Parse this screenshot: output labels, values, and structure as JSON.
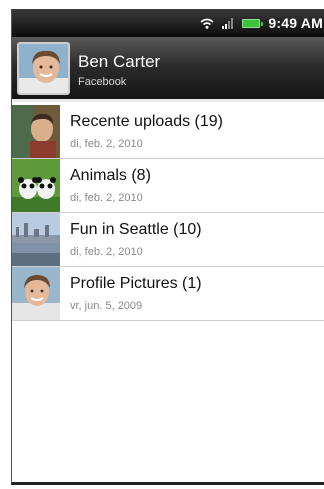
{
  "status_bar": {
    "time": "9:49 AM",
    "icons": [
      "wifi-icon",
      "signal-icon",
      "battery-icon"
    ],
    "battery_color": "#39c43a"
  },
  "header": {
    "name": "Ben Carter",
    "source": "Facebook"
  },
  "albums": [
    {
      "title": "Recente uploads (19)",
      "date": "di, feb. 2, 2010"
    },
    {
      "title": "Animals (8)",
      "date": "di, feb. 2, 2010"
    },
    {
      "title": "Fun in Seattle (10)",
      "date": "di, feb. 2, 2010"
    },
    {
      "title": "Profile Pictures (1)",
      "date": "vr, jun. 5, 2009"
    }
  ]
}
